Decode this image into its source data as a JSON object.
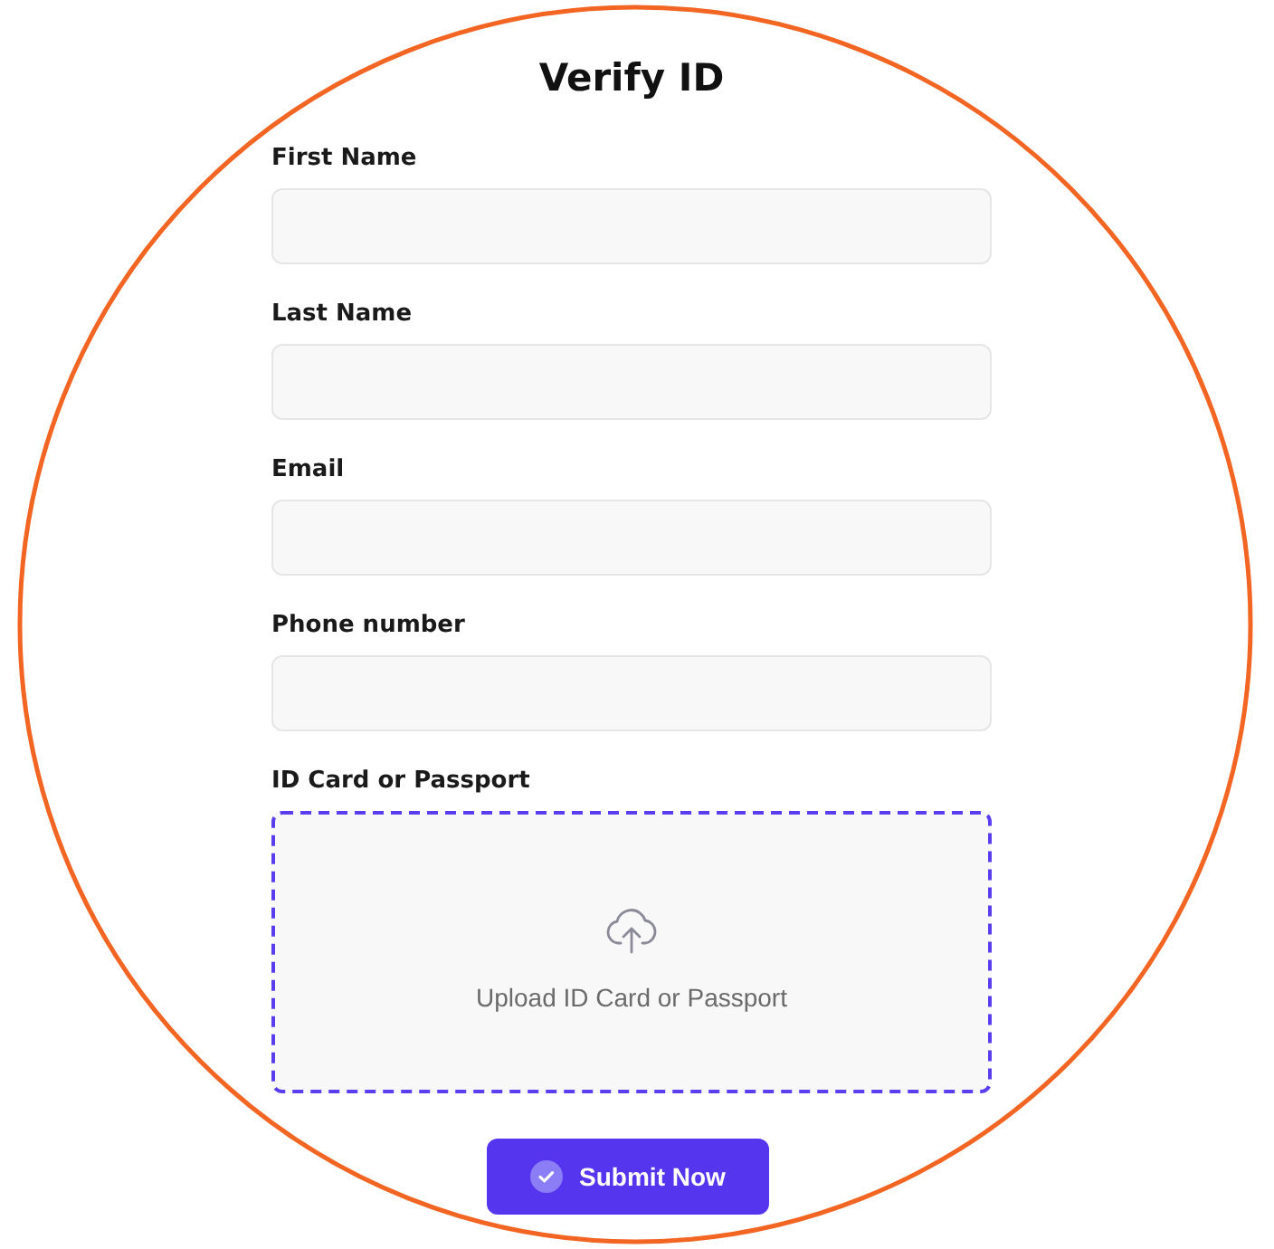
{
  "title": "Verify ID",
  "fields": [
    {
      "label": "First Name"
    },
    {
      "label": "Last Name"
    },
    {
      "label": "Email"
    },
    {
      "label": "Phone number"
    }
  ],
  "upload": {
    "label": "ID Card or Passport",
    "prompt": "Upload ID Card or Passport"
  },
  "submit_button": {
    "label": "Submit Now"
  }
}
